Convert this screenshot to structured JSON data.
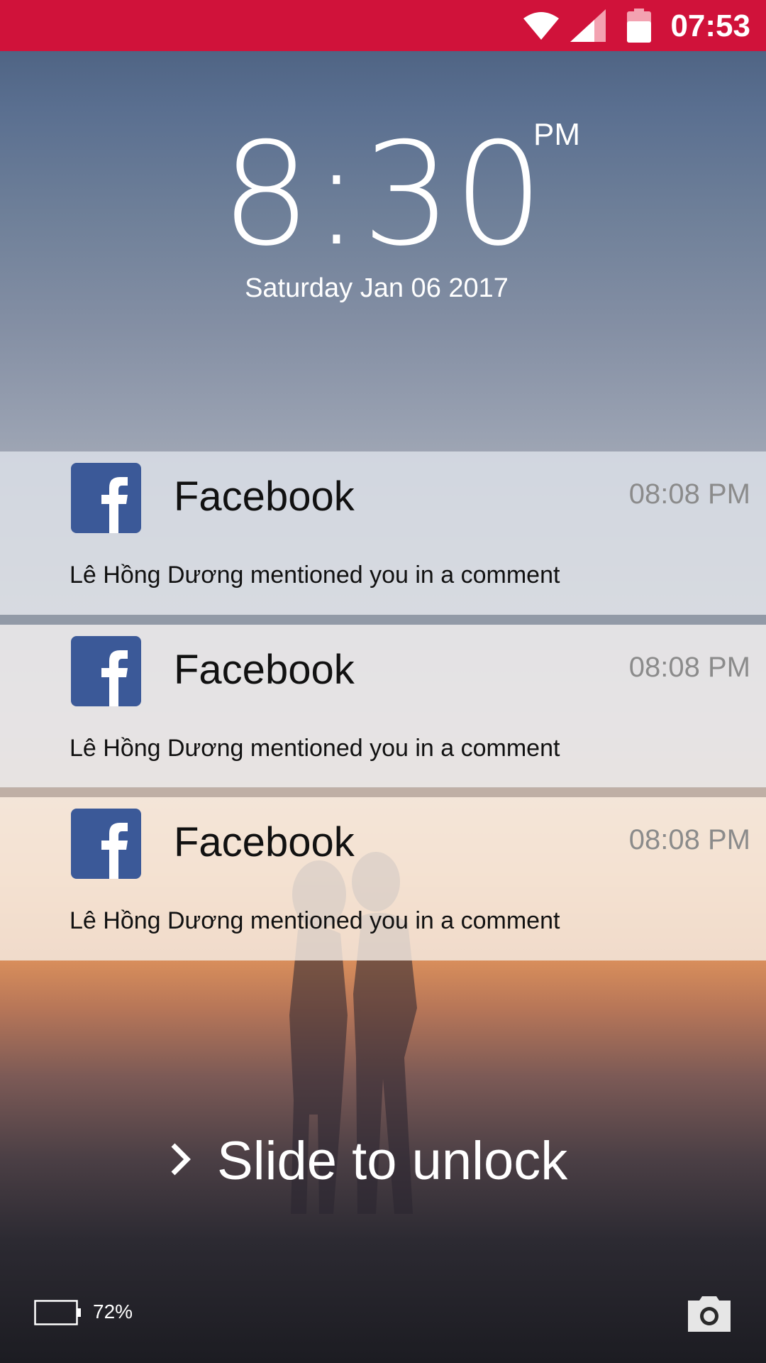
{
  "status_bar": {
    "time": "07:53",
    "color": "#d0123a",
    "icons": [
      "wifi-icon",
      "cell-signal-icon",
      "battery-icon"
    ]
  },
  "lock_clock": {
    "time": "8:30",
    "ampm": "PM",
    "date": "Saturday Jan 06 2017"
  },
  "notifications": [
    {
      "app": "Facebook",
      "time": "08:08 PM",
      "text": "Lê Hồng Dương mentioned you in a comment",
      "icon": "facebook-icon"
    },
    {
      "app": "Facebook",
      "time": "08:08 PM",
      "text": "Lê Hồng Dương mentioned you in a comment",
      "icon": "facebook-icon"
    },
    {
      "app": "Facebook",
      "time": "08:08 PM",
      "text": "Lê Hồng Dương mentioned you in a comment",
      "icon": "facebook-icon"
    }
  ],
  "unlock": {
    "label": "Slide to unlock",
    "icon": "chevron-right-icon"
  },
  "bottom_bar": {
    "battery_percent": "72%",
    "battery_level": 0.72,
    "camera_icon": "camera-icon"
  },
  "colors": {
    "facebook_blue": "#3b5998"
  }
}
